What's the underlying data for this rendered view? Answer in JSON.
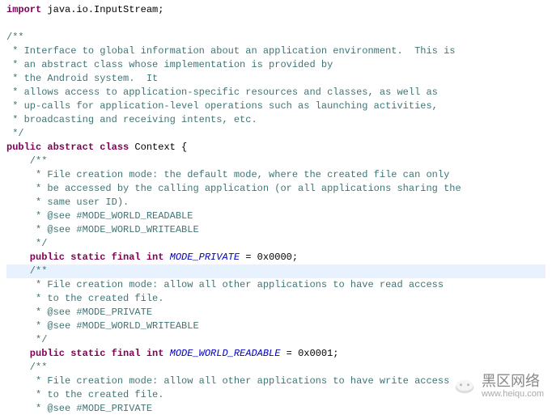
{
  "lines": {
    "l1_kw": "import",
    "l1_rest": " java.io.InputStream;",
    "jdoc1_open": "/**",
    "jdoc1_a": " * Interface to global information about an application environment.  This is",
    "jdoc1_b": " * an abstract class whose implementation is provided by",
    "jdoc1_c": " * the Android system.  It",
    "jdoc1_d": " * allows access to application-specific resources and classes, as well as",
    "jdoc1_e": " * up-calls for application-level operations such as launching activities,",
    "jdoc1_f": " * broadcasting and receiving intents, etc.",
    "jdoc1_close": " */",
    "decl_kw": "public abstract class",
    "decl_name": " Context {",
    "jdoc2_open": "    /**",
    "jdoc2_a": "     * File creation mode: the default mode, where the created file can only",
    "jdoc2_b": "     * be accessed by the calling application (or all applications sharing the",
    "jdoc2_c": "     * same user ID).",
    "jdoc2_d": "     * @see #MODE_WORLD_READABLE",
    "jdoc2_e": "     * @see #MODE_WORLD_WRITEABLE",
    "jdoc2_close": "     */",
    "f1_kw": "    public static final int",
    "f1_name": " MODE_PRIVATE",
    "f1_rest": " = 0x0000;",
    "jdoc3_open": "    /**",
    "jdoc3_a": "     * File creation mode: allow all other applications to have read access",
    "jdoc3_b": "     * to the created file.",
    "jdoc3_c": "     * @see #MODE_PRIVATE",
    "jdoc3_d": "     * @see #MODE_WORLD_WRITEABLE",
    "jdoc3_close": "     */",
    "f2_kw": "    public static final int",
    "f2_name": " MODE_WORLD_READABLE",
    "f2_rest": " = 0x0001;",
    "jdoc4_open": "    /**",
    "jdoc4_a": "     * File creation mode: allow all other applications to have write access",
    "jdoc4_b": "     * to the created file.",
    "jdoc4_c": "     * @see #MODE_PRIVATE"
  },
  "watermark": {
    "text": "黑区网络",
    "url": "www.heiqu.com"
  }
}
